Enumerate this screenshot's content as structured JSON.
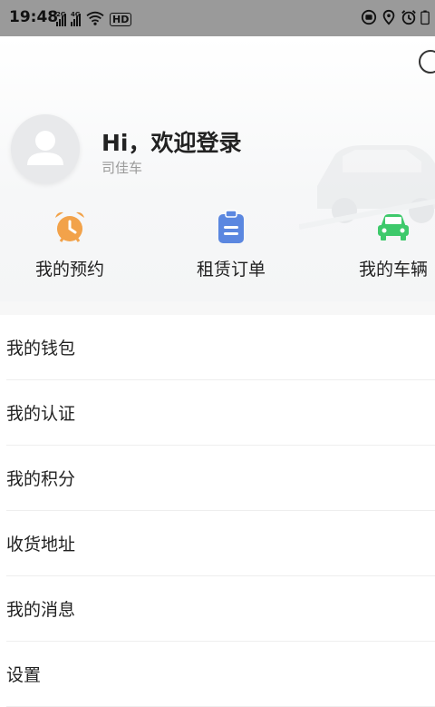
{
  "status_bar": {
    "time": "19:48",
    "signal_1_label": "2G",
    "signal_2_label": "4G",
    "hd_label": "HD",
    "icons": [
      "signal-icon",
      "signal-icon",
      "wifi-icon",
      "hd-icon",
      "camera-icon",
      "location-icon",
      "alarm-icon",
      "battery-icon"
    ]
  },
  "profile": {
    "greeting": "Hi，欢迎登录",
    "subtitle": "司佳车"
  },
  "quick_actions": [
    {
      "label": "我的预约",
      "icon": "alarm-clock-icon",
      "color": "#f2a24a"
    },
    {
      "label": "租赁订单",
      "icon": "clipboard-icon",
      "color": "#5b87e0"
    },
    {
      "label": "我的车辆",
      "icon": "car-icon",
      "color": "#3ec96b"
    }
  ],
  "menu": [
    {
      "label": "我的钱包"
    },
    {
      "label": "我的认证"
    },
    {
      "label": "我的积分"
    },
    {
      "label": "收货地址"
    },
    {
      "label": "我的消息"
    },
    {
      "label": "设置"
    }
  ]
}
